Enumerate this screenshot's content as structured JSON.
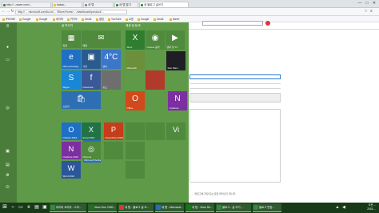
{
  "browser": {
    "tabs": [
      {
        "label": "http://...naver.com/..."
      },
      {
        "label": "kakao..."
      },
      {
        "label": "새 탭"
      },
      {
        "label": "새 탭 열기"
      },
      {
        "label": "새 블로그 글쓰기"
      }
    ],
    "window_controls": {
      "minimize": "—",
      "maximize": "□",
      "close": "✕"
    },
    "address": "http://... .microsoft.com/ko-kr/... /Store/Home/... /dashboard/product/...",
    "bookmarks": [
      {
        "label": "iPHONE"
      },
      {
        "label": "Google"
      },
      {
        "label": "Google"
      },
      {
        "label": "네이버"
      },
      {
        "label": "카카오"
      },
      {
        "label": "Gmail"
      },
      {
        "label": "알림"
      },
      {
        "label": "YouTube"
      },
      {
        "label": "쇼핑"
      },
      {
        "label": "Google"
      },
      {
        "label": "Gmail"
      },
      {
        "label": "Naver"
      }
    ]
  },
  "start_menu": {
    "group_left_title": "삶 보이기",
    "group_right_title": "재생 및 탐색",
    "rail_icons": [
      "hamburger-icon",
      "user-icon",
      "documents-icon",
      "settings-icon",
      "power-icon"
    ],
    "tiles": [
      {
        "name": "calendar",
        "label": "일정",
        "glyph": "▦",
        "color": "#4f8a3d"
      },
      {
        "name": "mail",
        "label": "메일",
        "glyph": "✉",
        "color": "#4f8a3d"
      },
      {
        "name": "edge",
        "label": "Microsoft Edge",
        "glyph": "e",
        "color": "#1f6fc5"
      },
      {
        "name": "photos",
        "label": "사진",
        "glyph": "▣",
        "color": "#2a5b8f"
      },
      {
        "name": "weather",
        "label": "날씨",
        "glyph": "4°C",
        "color": "#3b76c9"
      },
      {
        "name": "skype",
        "label": "Skype",
        "glyph": "S",
        "color": "#1a86d6"
      },
      {
        "name": "facebook",
        "label": "Facebook",
        "glyph": "f",
        "color": "#3b5998"
      },
      {
        "name": "news",
        "label": "뉴스",
        "glyph": "",
        "color": "#6e6e6e"
      },
      {
        "name": "onenote",
        "label": "OneNote",
        "glyph": "N",
        "color": "#7c2fa1"
      },
      {
        "name": "store",
        "label": "스토어",
        "glyph": "🛍",
        "color": "#2e6fb3"
      },
      {
        "name": "solitaire",
        "label": "Microsoft Solitaire Collection",
        "glyph": "♠",
        "color": "#2b6ec1"
      },
      {
        "name": "xbox",
        "label": "Xbox",
        "glyph": "X",
        "color": "#2f7d2f"
      },
      {
        "name": "groove",
        "label": "Groove 음악",
        "glyph": "◉",
        "color": "#4f8a3d"
      },
      {
        "name": "movies",
        "label": "영화 및 TV",
        "glyph": "▶",
        "color": "#4f8a3d"
      },
      {
        "name": "minecraft",
        "label": "Minecraft",
        "glyph": "",
        "color": "#6b8f3a"
      },
      {
        "name": "star-wars",
        "label": "Star Wars",
        "glyph": "",
        "color": "#1e1e24"
      },
      {
        "name": "game-1",
        "label": "",
        "glyph": "",
        "color": "#b13a2a"
      },
      {
        "name": "get-office",
        "label": "Office",
        "glyph": "O",
        "color": "#d24a1b"
      },
      {
        "name": "outlook",
        "label": "Outlook 2016",
        "glyph": "O",
        "color": "#1f6fc5"
      },
      {
        "name": "excel",
        "label": "Excel 2016",
        "glyph": "X",
        "color": "#217346"
      },
      {
        "name": "powerpoint",
        "label": "PowerPoint 2016",
        "glyph": "P",
        "color": "#c43e1c"
      },
      {
        "name": "onenote-2016",
        "label": "OneNote 2016",
        "glyph": "N",
        "color": "#7c2fa1"
      },
      {
        "name": "word",
        "label": "Word 2016",
        "glyph": "W",
        "color": "#2b579a"
      },
      {
        "name": "chrome",
        "label": "Chrome",
        "glyph": "◎",
        "color": "#4f8a3d"
      },
      {
        "name": "app-a",
        "label": "",
        "glyph": "",
        "color": "#4f8a3d"
      },
      {
        "name": "app-b",
        "label": "",
        "glyph": "",
        "color": "#4f8a3d"
      },
      {
        "name": "app-c",
        "label": "",
        "glyph": "",
        "color": "#4f8a3d"
      },
      {
        "name": "app-d",
        "label": "",
        "glyph": "",
        "color": "#4f8a3d"
      },
      {
        "name": "app-e",
        "label": "",
        "glyph": "",
        "color": "#4f8a3d"
      },
      {
        "name": "vi",
        "label": "",
        "glyph": "Vi",
        "color": "#4f8a3d"
      }
    ]
  },
  "taskbar": {
    "apps": [
      {
        "label": "네이버 코리아 - 스타..."
      },
      {
        "label": "Xbox One 1000..."
      },
      {
        "label": "새 탭 - 블로그 글 쓰..."
      },
      {
        "label": "새 탭 - Microsoft..."
      },
      {
        "label": "새 탭 - Xbox Re..."
      },
      {
        "label": "블로그 - 글 쓰기 ..."
      },
      {
        "label": "블로그 편집..."
      }
    ],
    "clock_time": "오전 ...",
    "clock_date": "2015-..."
  },
  "page": {
    "footnote": "... 블로그에 저장 또는 글로 불러오기 합니다."
  }
}
